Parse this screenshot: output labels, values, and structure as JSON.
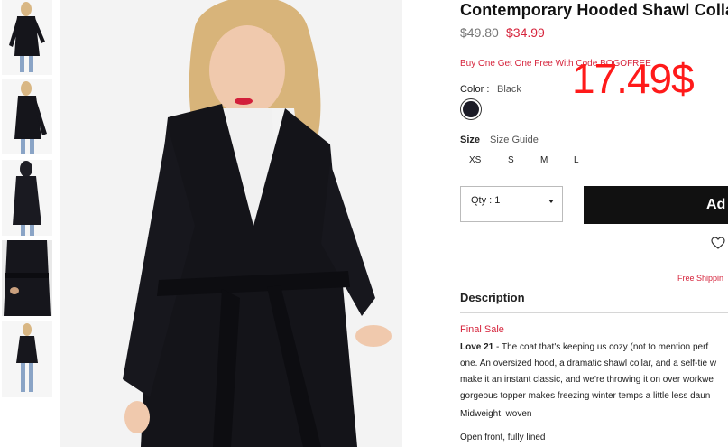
{
  "product": {
    "title": "Contemporary Hooded Shawl Colla",
    "old_price": "$49.80",
    "new_price": "$34.99",
    "promo": "Buy One Get One Free With Code BOGOFREE",
    "overlay_price": "17.49$",
    "color_label": "Color :",
    "color_value": "Black",
    "swatch_color": "#1b1b26",
    "size_label": "Size",
    "size_guide": "Size Guide",
    "sizes": [
      "XS",
      "S",
      "M",
      "L"
    ],
    "qty_label": "Qty : 1",
    "add_button": "Ad",
    "shipping": "Free Shippin",
    "description_title": "Description",
    "final_sale": "Final Sale",
    "description": {
      "brand": "Love 21",
      "line1": " - The coat that's keeping us cozy (not to mention perf",
      "line2": "one. An oversized hood, a dramatic shawl collar, and a self-tie w",
      "line3": "make it an instant classic, and we're throwing it on over workwe",
      "line4": "gorgeous topper makes freezing winter temps a little less daun",
      "extra1": "Midweight, woven",
      "extra2": "Open front, fully lined"
    }
  },
  "gallery": {
    "thumb_count": 5,
    "main_image_alt": "Model wearing black hooded shawl collar coat"
  },
  "icons": {
    "heart": "heart-icon",
    "caret": "chevron-down-icon"
  }
}
